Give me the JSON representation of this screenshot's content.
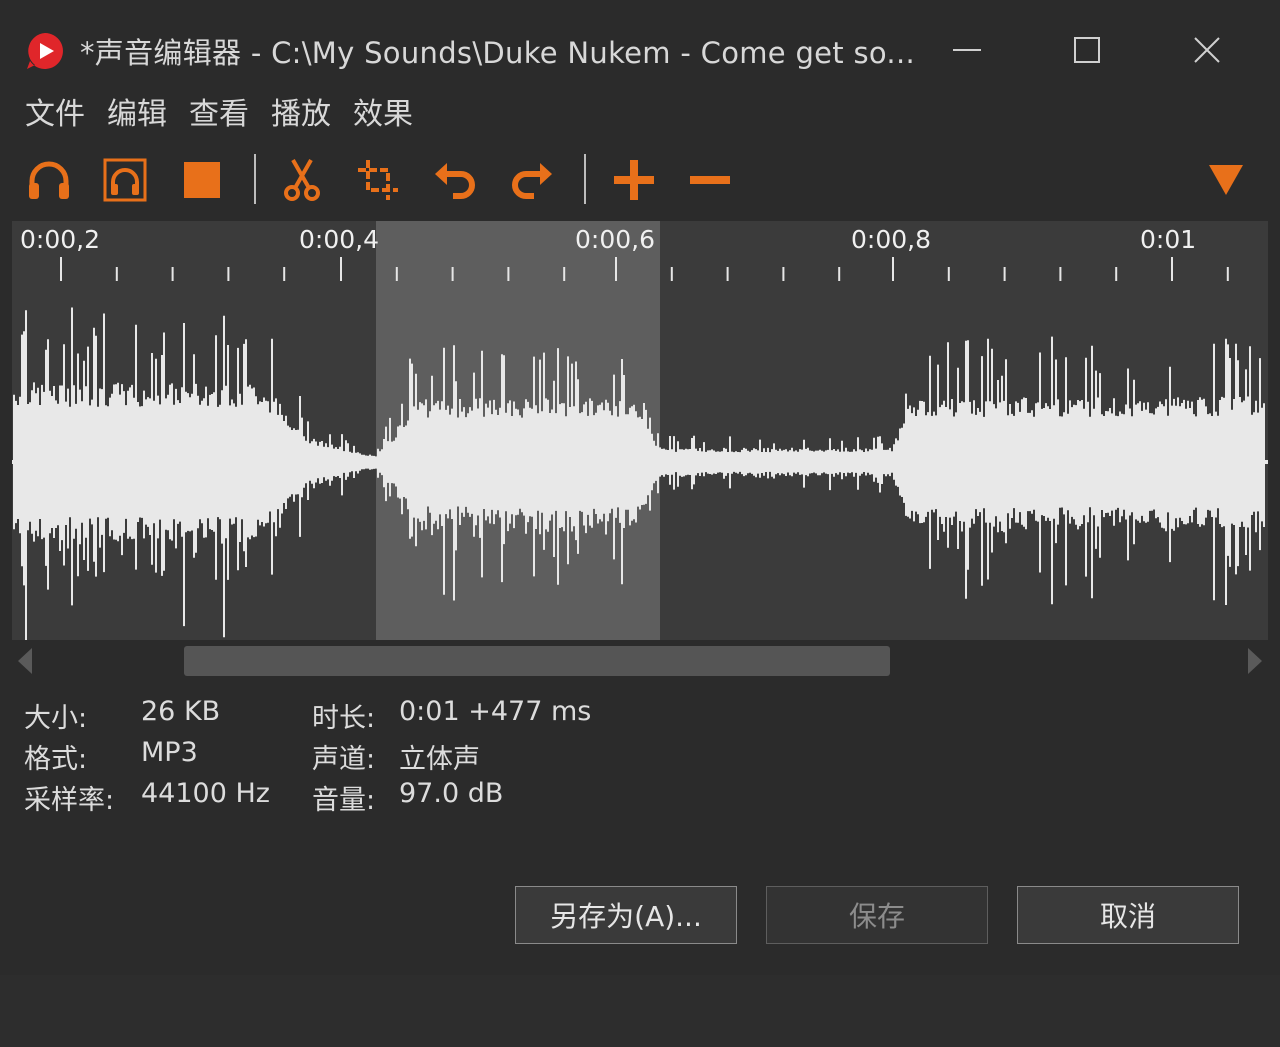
{
  "window": {
    "title": "*声音编辑器 - C:\\My Sounds\\Duke Nukem - Come get so...",
    "app_icon": "play-logo-icon",
    "controls": [
      "minimize-icon",
      "maximize-icon",
      "close-icon"
    ]
  },
  "menu": {
    "file": "文件",
    "edit": "编辑",
    "view": "查看",
    "play": "播放",
    "effects": "效果"
  },
  "toolbar": {
    "icons": [
      "headphones-icon",
      "headphones-selection-icon",
      "stop-icon",
      "cut-icon",
      "crop-icon",
      "undo-icon",
      "redo-icon",
      "zoom-in-plus-icon",
      "zoom-out-minus-icon",
      "dropdown-triangle-icon"
    ],
    "accent": "#e8701a"
  },
  "ruler": {
    "labels": [
      "0:00,2",
      "0:00,4",
      "0:00,6",
      "0:00,8",
      "0:01"
    ]
  },
  "waveform": {
    "background": "#3b3b3b",
    "selection_color": "#5e5e5e",
    "wave_color": "#e8e8e8",
    "selection_start_s": 0.4,
    "selection_end_s": 0.6
  },
  "info": {
    "size_label": "大小:",
    "size_value": "26 KB",
    "format_label": "格式:",
    "format_value": "MP3",
    "rate_label": "采样率:",
    "rate_value": "44100 Hz",
    "duration_label": "时长:",
    "duration_value": "0:01 +477 ms",
    "channels_label": "声道:",
    "channels_value": "立体声",
    "volume_label": "音量:",
    "volume_value": "97.0 dB"
  },
  "buttons": {
    "save_as": "另存为(A)...",
    "save": "保存",
    "cancel": "取消"
  }
}
